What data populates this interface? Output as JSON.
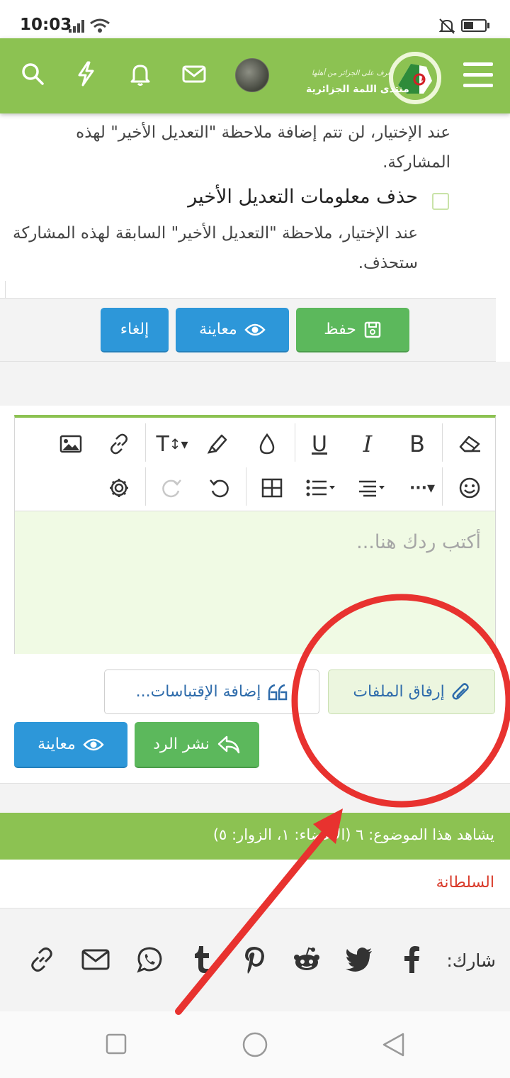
{
  "status_bar": {
    "time": "10:03"
  },
  "header": {
    "logo_text": "منتدى اللمة الجزائرية",
    "logo_tagline": "تعرف على الجزائر من أهلها",
    "icons": [
      "menu-icon",
      "search-icon",
      "lightning-icon",
      "bell-icon",
      "mail-icon"
    ]
  },
  "edit_options": {
    "silent_edit_description": "عند الإختيار، لن تتم إضافة ملاحظة \"التعديل الأخير\" لهذه المشاركة.",
    "delete_edit_label": "حذف معلومات التعديل الأخير",
    "delete_edit_description": "عند الإختيار، ملاحظة \"التعديل الأخير\" السابقة لهذه المشاركة ستحذف."
  },
  "actions": {
    "save_label": "حفظ",
    "preview_label": "معاينة",
    "cancel_label": "إلغاء"
  },
  "editor": {
    "placeholder": "أكتب ردك هنا...",
    "toolbar_row1": [
      "eraser-icon",
      "bold-icon",
      "italic-icon",
      "underline-icon",
      "color-drop-icon",
      "highlighter-icon",
      "text-size-icon",
      "link-icon",
      "image-icon"
    ],
    "toolbar_row2": [
      "smiley-icon",
      "more-icon",
      "align-icon",
      "list-icon",
      "table-icon",
      "undo-icon",
      "redo-icon",
      "settings-icon"
    ],
    "bold_glyph": "B",
    "italic_glyph": "I",
    "underline_glyph": "U",
    "textsize_glyph": "T"
  },
  "reply": {
    "attach_label": "إرفاق الملفات",
    "quotes_label": "إضافة الإقتباسات...",
    "post_label": "نشر الرد",
    "preview_label": "معاينة"
  },
  "viewers": {
    "text": "يشاهد هذا الموضوع: ٦ (الأعضاء: ١، الزوار: ٥)",
    "member_name": "السلطانة"
  },
  "share": {
    "label": "شارك:",
    "icons": [
      "facebook-icon",
      "twitter-icon",
      "reddit-icon",
      "pinterest-icon",
      "tumblr-icon",
      "whatsapp-icon",
      "email-icon",
      "link-icon"
    ]
  },
  "colors": {
    "brand_green": "#8cc252",
    "button_green": "#5cb85c",
    "button_blue": "#2d97d9",
    "editor_bg": "#f0fae4",
    "annotation_red": "#e8322f"
  }
}
